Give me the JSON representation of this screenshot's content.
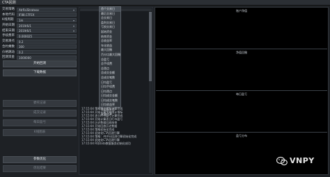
{
  "window": {
    "title": "CTA回测"
  },
  "form": {
    "rows": [
      {
        "label": "交易策略",
        "value": "AtrRsiStrategy",
        "dropdown": true
      },
      {
        "label": "本地代码",
        "value": "IF88.CFFEX",
        "dropdown": false
      },
      {
        "label": "K线周期",
        "value": "1m",
        "dropdown": true
      },
      {
        "label": "开始日期",
        "value": "2019/6/1",
        "dropdown": true
      },
      {
        "label": "结束日期",
        "value": "2019/6/1",
        "dropdown": true
      },
      {
        "label": "手续费率",
        "value": "0.000025",
        "dropdown": false
      },
      {
        "label": "交易滑点",
        "value": "0.2",
        "dropdown": false
      },
      {
        "label": "合约乘数",
        "value": "300",
        "dropdown": false
      },
      {
        "label": "价格跳动",
        "value": "0.2",
        "dropdown": false
      },
      {
        "label": "回测资金",
        "value": "1000000",
        "dropdown": false
      }
    ]
  },
  "buttons": {
    "start_backtest": "开始回测",
    "download_data": "下载数据",
    "order_records": "委托记录",
    "trade_records": "成交记录",
    "daily_pnl": "每日盈亏",
    "k_chart": "K线图表",
    "optimize": "参数优化",
    "opt_result": "优化结果"
  },
  "dropdown_menu": {
    "items": [
      "首个交易日",
      "最后交易日",
      "总交易日",
      "盈利交易日",
      "亏损交易日",
      "起始资金",
      "结束资金",
      "总收益率",
      "年化收益",
      "最大回撤",
      "百分比最大回撤",
      "总盈亏",
      "总手续费",
      "总滑点",
      "总成交金额",
      "总成交笔数",
      "日均盈亏",
      "日均手续费",
      "日均滑点",
      "日均成交金额",
      "日均成交笔数",
      "日均收益率",
      "收益标准差",
      "夏普比率"
    ],
    "selected_index": 0
  },
  "log": {
    "lines": [
      "17:15:04  策略统计指标计算完成",
      "17:15:04  开始计算策略统计指标",
      "17:15:04  逐日盯市盈亏计算完成",
      "17:15:04  开始计算逐日盯市盈亏",
      "17:15:04  历史数据回放结束",
      "17:15:04  开始回放历史数据",
      "17:15:04  策略初始化完成",
      "17:15:04  初始化CTA回测引擎",
      "17:15:04  策略：AtrRsi回测引擎初始化完成",
      "17:15:04  初始化CTA回测引擎",
      "17:15:04  RQData数据服务初始化成功"
    ]
  },
  "charts": {
    "titles": [
      "账户净值",
      "净值回撤",
      "每日盈亏",
      "盈亏分布"
    ]
  },
  "watermark": {
    "text": "VNPY",
    "icon": "wechat-icon"
  }
}
